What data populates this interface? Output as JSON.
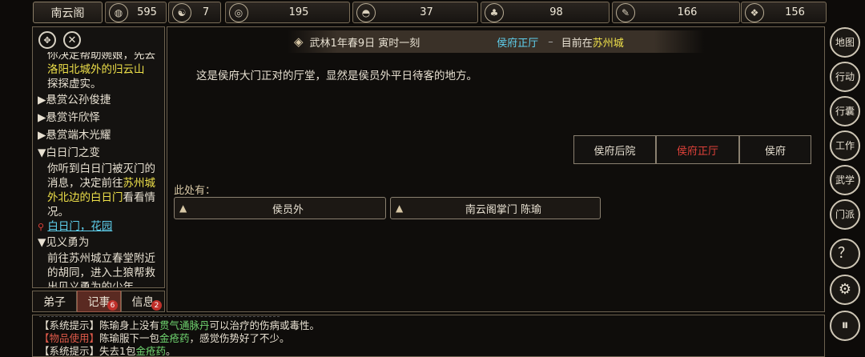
{
  "topbar": {
    "location_button": "南云阁",
    "stats": [
      {
        "icon": "coin-icon",
        "glyph": "◍",
        "value": "595"
      },
      {
        "icon": "yin-yang-icon",
        "glyph": "☯",
        "value": "7"
      },
      {
        "icon": "ring-icon",
        "glyph": "◎",
        "value": "195"
      },
      {
        "icon": "food-bowl-icon",
        "glyph": "◓",
        "value": "37"
      },
      {
        "icon": "herb-icon",
        "glyph": "♣",
        "value": "98"
      },
      {
        "icon": "scroll-icon",
        "glyph": "✎",
        "value": "166"
      },
      {
        "icon": "wood-icon",
        "glyph": "❖",
        "value": "156"
      }
    ]
  },
  "left_panel": {
    "quest_intro": [
      "你决定帮助婉娘，先去",
      "洛阳北城外的归云山",
      "探探虚实。"
    ],
    "quests": [
      {
        "label": "悬赏公孙俊捷"
      },
      {
        "label": "悬赏许欣怿"
      },
      {
        "label": "悬赏端木光耀"
      }
    ],
    "quest_white": {
      "title": "白日门之变",
      "desc_1": "你听到白日门被灭门的",
      "desc_2": "消息，决定前往",
      "desc_hl_1": "苏州城",
      "desc_hl_2": "外北边的白日门",
      "desc_3": "看看情",
      "desc_4": "况。",
      "location": "白日门，花园"
    },
    "quest_brave": {
      "title": "见义勇为",
      "desc_lines": [
        "前往苏州城立春堂附近",
        "的胡同，进入土狼帮救",
        "出见义勇为的少年"
      ]
    },
    "tabs": [
      {
        "label": "弟子",
        "badge": ""
      },
      {
        "label": "记事",
        "badge": "6"
      },
      {
        "label": "信息",
        "badge": "2"
      }
    ]
  },
  "main": {
    "date_time": "武林1年春9日 寅时一刻",
    "room_name": "侯府正厅",
    "separator": "–",
    "current_prefix": "目前在",
    "current_city": "苏州城",
    "description": "这是侯府大门正对的厅堂，显然是侯员外平日待客的地方。",
    "exits": [
      {
        "label": "侯府后院",
        "current": false
      },
      {
        "label": "侯府正厅",
        "current": true
      },
      {
        "label": "侯府",
        "current": false
      }
    ],
    "here_label": "此处有：",
    "npcs": [
      {
        "name": "侯员外"
      },
      {
        "name": "南云阁掌门 陈瑜"
      }
    ]
  },
  "right_menu": [
    {
      "label": "地图",
      "icon": "map-icon"
    },
    {
      "label": "行动",
      "icon": "action-icon"
    },
    {
      "label": "行囊",
      "icon": "bag-icon"
    },
    {
      "label": "工作",
      "icon": "work-icon"
    },
    {
      "label": "武学",
      "icon": "martial-icon"
    },
    {
      "label": "门派",
      "icon": "sect-icon"
    },
    {
      "label": "？",
      "icon": "help-icon"
    },
    {
      "label": "⚙",
      "icon": "settings-icon"
    },
    {
      "label": "⏸",
      "icon": "pause-icon"
    }
  ],
  "log": [
    {
      "tag": "【系统提示】",
      "tag_color": "#e8e1d2",
      "parts": [
        [
          "陈瑜身上没有",
          "#e8e1d2"
        ],
        [
          "贯气通脉丹",
          "#6fd36f"
        ],
        [
          "可以治疗的伤病或毒性。",
          "#e8e1d2"
        ]
      ]
    },
    {
      "tag": "【物品使用】",
      "tag_color": "#e05a4a",
      "parts": [
        [
          "陈瑜服下一包",
          "#e8e1d2"
        ],
        [
          "金疮药",
          "#6fd36f"
        ],
        [
          "，感觉伤势好了不少。",
          "#e8e1d2"
        ]
      ]
    },
    {
      "tag": "【系统提示】",
      "tag_color": "#e8e1d2",
      "parts": [
        [
          "失去1包",
          "#e8e1d2"
        ],
        [
          "金疮药",
          "#6fd36f"
        ],
        [
          "。",
          "#e8e1d2"
        ]
      ]
    }
  ],
  "colors": {
    "accent_gold": "#f0e24a",
    "current_exit": "#e0413a",
    "city_link": "#5fd0ee",
    "room_name": "#5fd0ee"
  }
}
